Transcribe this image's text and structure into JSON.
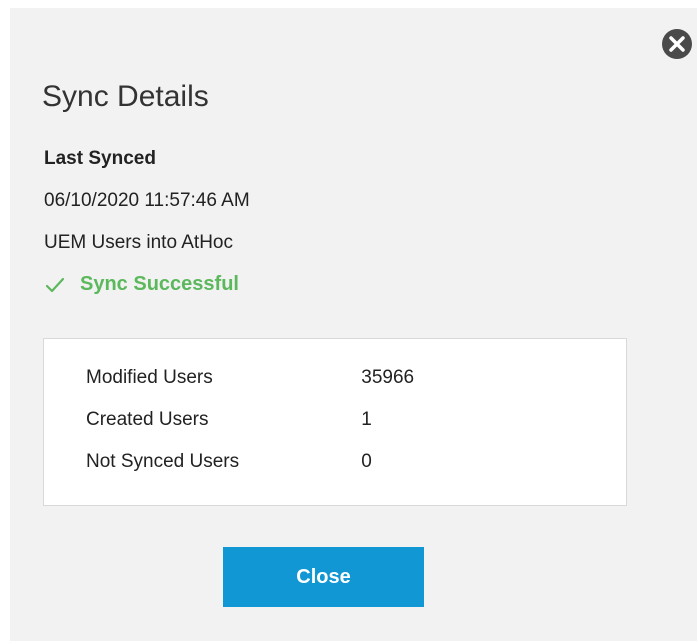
{
  "dialog": {
    "title": "Sync Details",
    "close_icon": "close-circle-icon",
    "last_synced_label": "Last Synced",
    "last_synced_value": "06/10/2020 11:57:46 AM",
    "sync_description": "UEM Users into AtHoc",
    "status": {
      "icon": "checkmark-icon",
      "text": "Sync Successful",
      "color": "#5cb85c"
    },
    "stats": [
      {
        "label": "Modified Users",
        "value": "35966"
      },
      {
        "label": "Created Users",
        "value": "1"
      },
      {
        "label": "Not Synced Users",
        "value": "0"
      }
    ],
    "close_button_label": "Close",
    "accent_color": "#1197d3"
  }
}
